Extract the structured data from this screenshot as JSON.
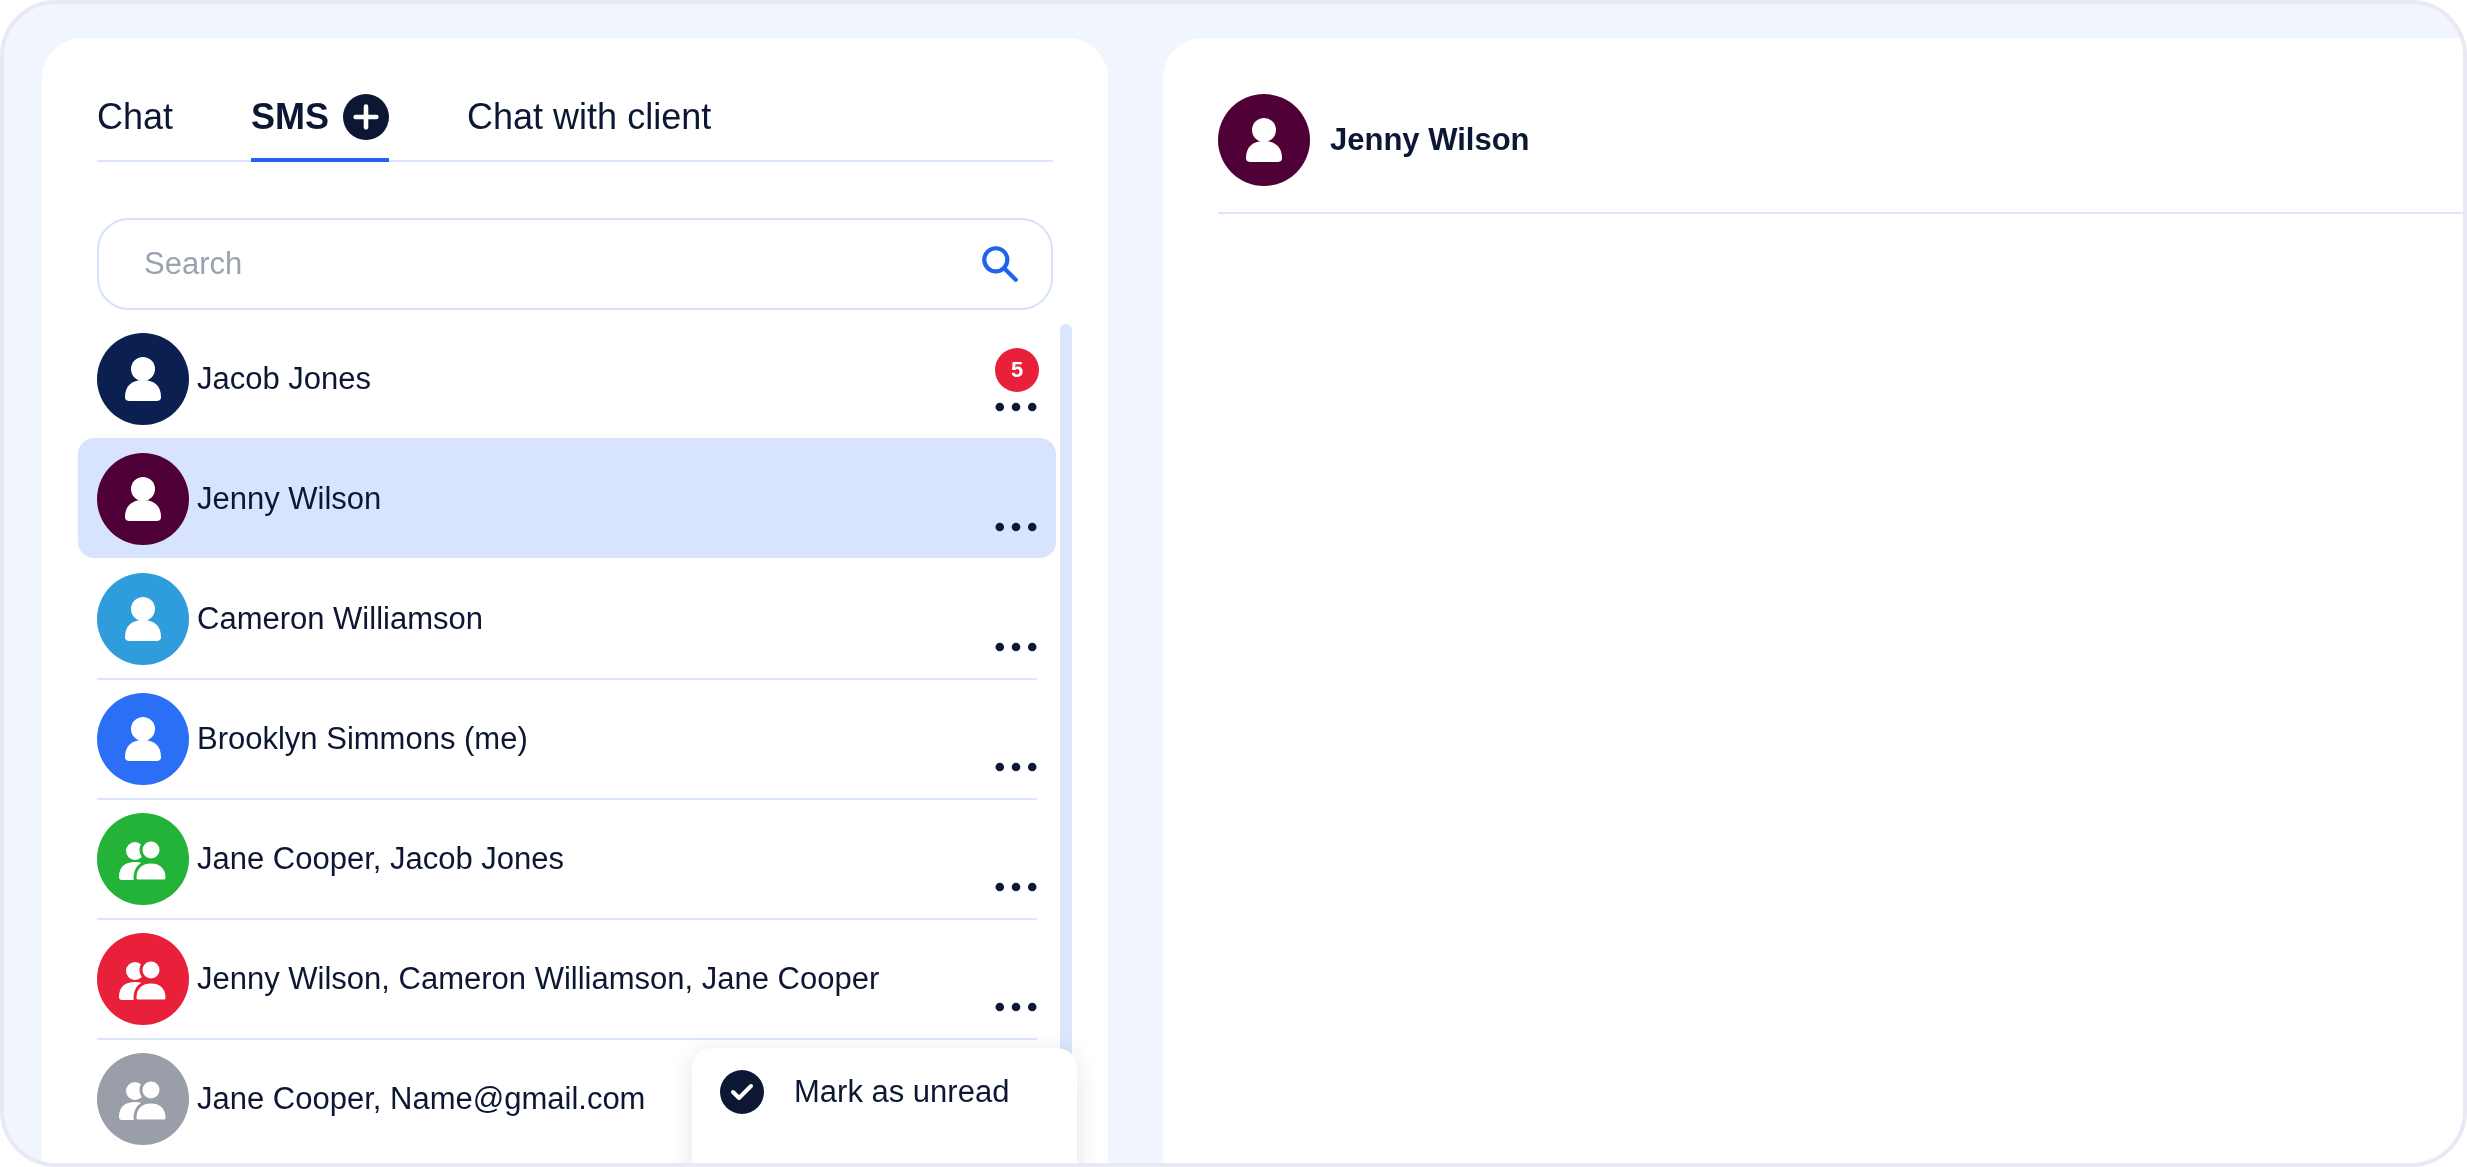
{
  "tabs": [
    {
      "label": "Chat",
      "selected": false,
      "add_button": false
    },
    {
      "label": "SMS",
      "selected": true,
      "add_button": true
    },
    {
      "label": "Chat with client",
      "selected": false,
      "add_button": false
    }
  ],
  "search": {
    "placeholder": "Search"
  },
  "conversations": [
    {
      "name": "Jacob Jones",
      "kind": "person",
      "color": "#0b2050",
      "selected": false,
      "badge": "5"
    },
    {
      "name": "Jenny Wilson",
      "kind": "person",
      "color": "#4f0036",
      "selected": true
    },
    {
      "name": "Cameron Williamson",
      "kind": "person",
      "color": "#2f9ddb",
      "selected": false
    },
    {
      "name": "Brooklyn Simmons (me)",
      "kind": "person",
      "color": "#2a6ff6",
      "selected": false
    },
    {
      "name": "Jane Cooper, Jacob Jones",
      "kind": "group",
      "color": "#22b338",
      "selected": false
    },
    {
      "name": "Jenny Wilson, Cameron Williamson, Jane Cooper",
      "kind": "group",
      "color": "#e8203a",
      "selected": false
    },
    {
      "name": "Jane Cooper, Name@gmail.com",
      "kind": "group",
      "color": "#9a9ea8",
      "selected": false
    }
  ],
  "context_menu": {
    "items": [
      {
        "label": "Mark as unread"
      }
    ]
  },
  "chat_header": {
    "name": "Jenny Wilson",
    "kind": "person",
    "color": "#4f0036"
  }
}
